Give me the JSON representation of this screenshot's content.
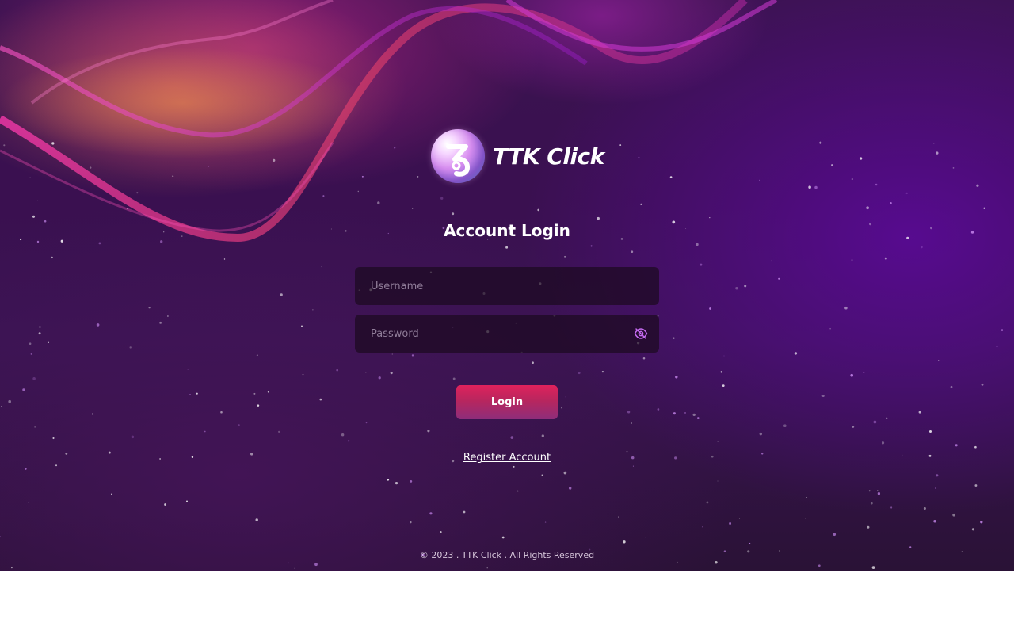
{
  "brand": {
    "name": "TTK Click",
    "logo_icon": "ttk-orb-logo"
  },
  "login": {
    "heading": "Account Login",
    "username_placeholder": "Username",
    "password_placeholder": "Password",
    "password_toggle_icon": "eye-off-icon",
    "submit_label": "Login",
    "register_link": "Register Account"
  },
  "footer": {
    "copyright": "© 2023 . TTK Click . All Rights Reserved"
  },
  "colors": {
    "accent": "#e0225c",
    "accent_end": "#8e2d7a",
    "eye_icon": "#c46bf0",
    "background": "#3a1050"
  }
}
